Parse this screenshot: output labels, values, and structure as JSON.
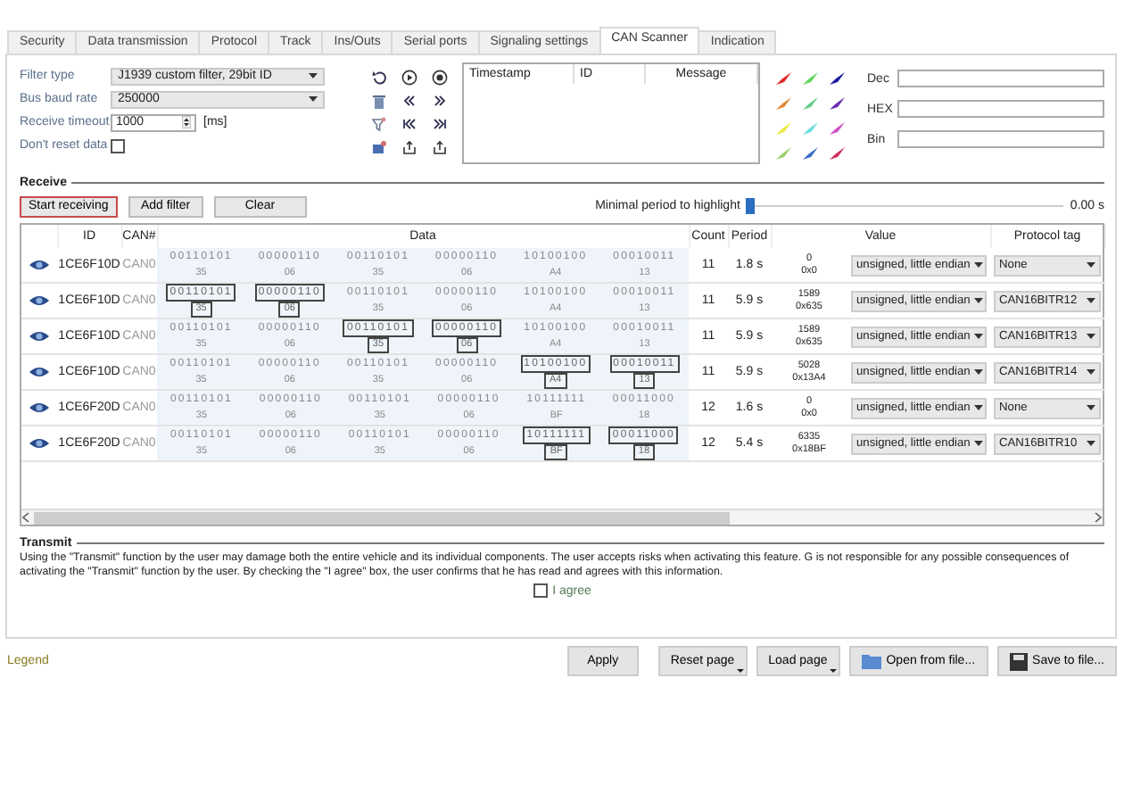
{
  "tabs": [
    {
      "label": "Security",
      "selected": false
    },
    {
      "label": "Data transmission",
      "selected": false
    },
    {
      "label": "Protocol",
      "selected": false
    },
    {
      "label": "Track",
      "selected": false
    },
    {
      "label": "Ins/Outs",
      "selected": false
    },
    {
      "label": "Serial ports",
      "selected": false
    },
    {
      "label": "Signaling settings",
      "selected": false
    },
    {
      "label": "CAN Scanner",
      "selected": true
    },
    {
      "label": "Indication",
      "selected": false
    }
  ],
  "filter": {
    "fields": [
      {
        "kind": "dropdown",
        "label": "Filter type",
        "value": "J1939 custom filter, 29bit ID"
      },
      {
        "kind": "dropdown",
        "label": "Bus baud rate",
        "value": "250000"
      },
      {
        "kind": "spinner",
        "label": "Receive timeout",
        "value": "1000",
        "unit": "[ms]"
      },
      {
        "kind": "checkbox",
        "label": "Don't reset data",
        "checked": false
      }
    ]
  },
  "message_list": {
    "columns": [
      "Timestamp",
      "ID",
      "Message"
    ]
  },
  "palette": [
    {
      "color": "#e02828"
    },
    {
      "color": "#5cd65c"
    },
    {
      "color": "#1a1aa0"
    },
    {
      "color": "#e08a3a"
    },
    {
      "color": "#66cc88"
    },
    {
      "color": "#6a2ab0"
    },
    {
      "color": "#e8e840"
    },
    {
      "color": "#66dddd"
    },
    {
      "color": "#d050c8"
    },
    {
      "color": "#9ad06a"
    },
    {
      "color": "#3a6ec8"
    },
    {
      "color": "#d03060"
    }
  ],
  "converter": [
    {
      "label": "Dec"
    },
    {
      "label": "HEX"
    },
    {
      "label": "Bin"
    }
  ],
  "receive": {
    "title": "Receive",
    "buttons": [
      {
        "label": "Start receiving",
        "highlighted": true
      },
      {
        "label": "Add filter",
        "highlighted": false
      },
      {
        "label": "Clear",
        "highlighted": false
      }
    ],
    "slider": {
      "label": "Minimal period to highlight",
      "level": 0,
      "reading": "0.00 s"
    }
  },
  "table": {
    "columns": [
      "ID",
      "CAN#",
      "Data",
      "Count",
      "Period",
      "Value",
      "Protocol tag"
    ],
    "rows": [
      {
        "id": "1CE6F10D",
        "can": "CAN0",
        "bytes": [
          {
            "bin": "00110101",
            "hex": "35",
            "highlighted": false
          },
          {
            "bin": "00000110",
            "hex": "06",
            "highlighted": false
          },
          {
            "bin": "00110101",
            "hex": "35",
            "highlighted": false
          },
          {
            "bin": "00000110",
            "hex": "06",
            "highlighted": false
          },
          {
            "bin": "10100100",
            "hex": "A4",
            "highlighted": false
          },
          {
            "bin": "00010011",
            "hex": "13",
            "highlighted": false
          }
        ],
        "count": "11",
        "period": "1.8 s",
        "value_dec": "0",
        "value_hex": "0x0",
        "value_type": "unsigned, little endian",
        "protocol_tag": "None"
      },
      {
        "id": "1CE6F10D",
        "can": "CAN0",
        "bytes": [
          {
            "bin": "00110101",
            "hex": "35",
            "highlighted": true
          },
          {
            "bin": "00000110",
            "hex": "06",
            "highlighted": true
          },
          {
            "bin": "00110101",
            "hex": "35",
            "highlighted": false
          },
          {
            "bin": "00000110",
            "hex": "06",
            "highlighted": false
          },
          {
            "bin": "10100100",
            "hex": "A4",
            "highlighted": false
          },
          {
            "bin": "00010011",
            "hex": "13",
            "highlighted": false
          }
        ],
        "count": "11",
        "period": "5.9 s",
        "value_dec": "1589",
        "value_hex": "0x635",
        "value_type": "unsigned, little endian",
        "protocol_tag": "CAN16BITR12"
      },
      {
        "id": "1CE6F10D",
        "can": "CAN0",
        "bytes": [
          {
            "bin": "00110101",
            "hex": "35",
            "highlighted": false
          },
          {
            "bin": "00000110",
            "hex": "06",
            "highlighted": false
          },
          {
            "bin": "00110101",
            "hex": "35",
            "highlighted": true
          },
          {
            "bin": "00000110",
            "hex": "06",
            "highlighted": true
          },
          {
            "bin": "10100100",
            "hex": "A4",
            "highlighted": false
          },
          {
            "bin": "00010011",
            "hex": "13",
            "highlighted": false
          }
        ],
        "count": "11",
        "period": "5.9 s",
        "value_dec": "1589",
        "value_hex": "0x635",
        "value_type": "unsigned, little endian",
        "protocol_tag": "CAN16BITR13"
      },
      {
        "id": "1CE6F10D",
        "can": "CAN0",
        "bytes": [
          {
            "bin": "00110101",
            "hex": "35",
            "highlighted": false
          },
          {
            "bin": "00000110",
            "hex": "06",
            "highlighted": false
          },
          {
            "bin": "00110101",
            "hex": "35",
            "highlighted": false
          },
          {
            "bin": "00000110",
            "hex": "06",
            "highlighted": false
          },
          {
            "bin": "10100100",
            "hex": "A4",
            "highlighted": true
          },
          {
            "bin": "00010011",
            "hex": "13",
            "highlighted": true
          }
        ],
        "count": "11",
        "period": "5.9 s",
        "value_dec": "5028",
        "value_hex": "0x13A4",
        "value_type": "unsigned, little endian",
        "protocol_tag": "CAN16BITR14"
      },
      {
        "id": "1CE6F20D",
        "can": "CAN0",
        "bytes": [
          {
            "bin": "00110101",
            "hex": "35",
            "highlighted": false
          },
          {
            "bin": "00000110",
            "hex": "06",
            "highlighted": false
          },
          {
            "bin": "00110101",
            "hex": "35",
            "highlighted": false
          },
          {
            "bin": "00000110",
            "hex": "06",
            "highlighted": false
          },
          {
            "bin": "10111111",
            "hex": "BF",
            "highlighted": false
          },
          {
            "bin": "00011000",
            "hex": "18",
            "highlighted": false
          }
        ],
        "count": "12",
        "period": "1.6 s",
        "value_dec": "0",
        "value_hex": "0x0",
        "value_type": "unsigned, little endian",
        "protocol_tag": "None"
      },
      {
        "id": "1CE6F20D",
        "can": "CAN0",
        "bytes": [
          {
            "bin": "00110101",
            "hex": "35",
            "highlighted": false
          },
          {
            "bin": "00000110",
            "hex": "06",
            "highlighted": false
          },
          {
            "bin": "00110101",
            "hex": "35",
            "highlighted": false
          },
          {
            "bin": "00000110",
            "hex": "06",
            "highlighted": false
          },
          {
            "bin": "10111111",
            "hex": "BF",
            "highlighted": true
          },
          {
            "bin": "00011000",
            "hex": "18",
            "highlighted": true
          }
        ],
        "count": "12",
        "period": "5.4 s",
        "value_dec": "6335",
        "value_hex": "0x18BF",
        "value_type": "unsigned, little endian",
        "protocol_tag": "CAN16BITR10"
      }
    ]
  },
  "transmit": {
    "title": "Transmit",
    "text": "Using the \"Transmit\" function by the user may damage both the entire vehicle and its individual components. The user accepts risks when activating this feature. G is not responsible for any possible consequences of activating the \"Transmit\" function by the user. By checking the \"I agree\" box, the user confirms that he has read and agrees with this information.",
    "agree": {
      "label": "I agree",
      "checked": false
    }
  },
  "legend": "Legend",
  "buttons": [
    {
      "kind": "plain",
      "label": "Apply"
    },
    {
      "kind": "menu",
      "label": "Reset page"
    },
    {
      "kind": "menu",
      "label": "Load page"
    },
    {
      "kind": "folder",
      "label": "Open from file..."
    },
    {
      "kind": "disk",
      "label": "Save to file..."
    }
  ]
}
